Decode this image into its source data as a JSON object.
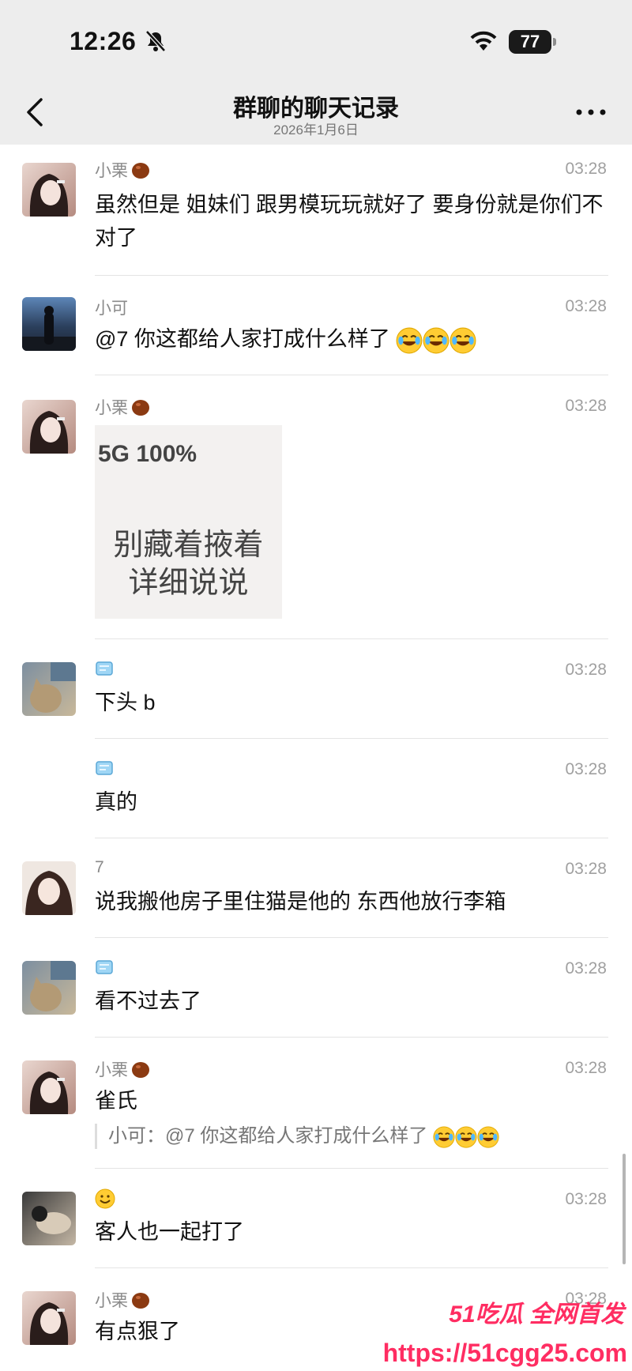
{
  "status": {
    "time": "12:26",
    "battery": "77"
  },
  "nav": {
    "title": "群聊的聊天记录",
    "subtitle": "2026年1月6日"
  },
  "messages": [
    {
      "sender": "小栗",
      "time": "03:28",
      "text": "虽然但是 姐妹们 跟男模玩玩就好了 要身份就是你们不对了"
    },
    {
      "sender": "小可",
      "time": "03:28",
      "text": "@7 你这都给人家打成什么样了"
    },
    {
      "sender": "小栗",
      "time": "03:28",
      "sticker": {
        "status": "5G 100%",
        "line1": "别藏着掖着",
        "line2": "详细说说"
      }
    },
    {
      "sender": "",
      "time": "03:28",
      "text": "下头 b"
    },
    {
      "sender": "",
      "time": "03:28",
      "text": "真的"
    },
    {
      "sender": "7",
      "time": "03:28",
      "text": "说我搬他房子里住猫是他的 东西他放行李箱"
    },
    {
      "sender": "",
      "time": "03:28",
      "text": "看不过去了"
    },
    {
      "sender": "小栗",
      "time": "03:28",
      "text": "雀氏",
      "quote": "小可：@7 你这都给人家打成什么样了"
    },
    {
      "sender": "",
      "time": "03:28",
      "text": "客人也一起打了"
    },
    {
      "sender": "小栗",
      "time": "03:28",
      "text": "有点狠了"
    }
  ],
  "watermark": {
    "title": "51吃瓜 全网首发",
    "url": "https://51cgg25.com"
  },
  "colors": {
    "background": "#ededed",
    "accent": "#ff2d62"
  }
}
